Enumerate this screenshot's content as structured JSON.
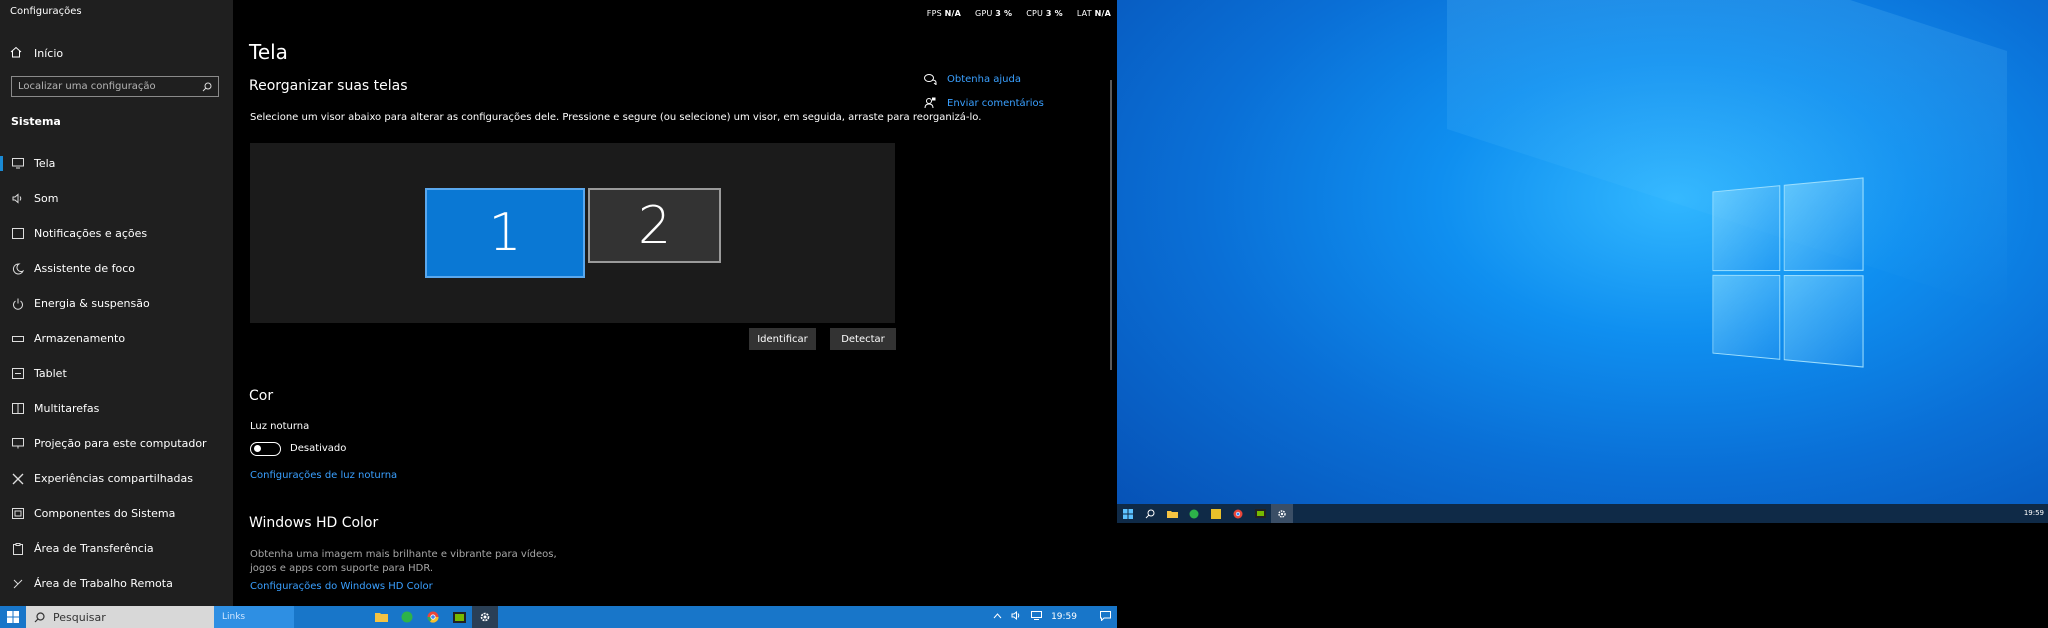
{
  "window": {
    "title": "Configurações"
  },
  "sidebar": {
    "home_label": "Início",
    "search_placeholder": "Localizar uma configuração",
    "group_label": "Sistema",
    "items": [
      {
        "label": "Tela",
        "icon": "display-icon"
      },
      {
        "label": "Som",
        "icon": "speaker-icon"
      },
      {
        "label": "Notificações e ações",
        "icon": "notification-icon"
      },
      {
        "label": "Assistente de foco",
        "icon": "moon-icon"
      },
      {
        "label": "Energia & suspensão",
        "icon": "power-icon"
      },
      {
        "label": "Armazenamento",
        "icon": "storage-icon"
      },
      {
        "label": "Tablet",
        "icon": "tablet-icon"
      },
      {
        "label": "Multitarefas",
        "icon": "multitask-icon"
      },
      {
        "label": "Projeção para este computador",
        "icon": "projection-icon"
      },
      {
        "label": "Experiências compartilhadas",
        "icon": "shared-icon"
      },
      {
        "label": "Componentes do Sistema",
        "icon": "components-icon"
      },
      {
        "label": "Área de Transferência",
        "icon": "clipboard-icon"
      },
      {
        "label": "Área de Trabalho Remota",
        "icon": "remote-icon"
      }
    ]
  },
  "overlay": {
    "fps_label": "FPS",
    "fps_value": "N/A",
    "gpu_label": "GPU",
    "gpu_value": "3 %",
    "cpu_label": "CPU",
    "cpu_value": "3 %",
    "lat_label": "LAT",
    "lat_value": "N/A"
  },
  "main": {
    "title": "Tela",
    "arrange_title": "Reorganizar suas telas",
    "arrange_desc": "Selecione um visor abaixo para alterar as configurações dele. Pressione e segure (ou selecione) um visor, em seguida, arraste para reorganizá-lo.",
    "monitor1_label": "1",
    "monitor2_label": "2",
    "identify_label": "Identificar",
    "detect_label": "Detectar",
    "color_title": "Cor",
    "night_light_label": "Luz noturna",
    "toggle_state": "Desativado",
    "night_light_link": "Configurações de luz noturna",
    "hdr_title": "Windows HD Color",
    "hdr_desc": "Obtenha uma imagem mais brilhante e vibrante para vídeos, jogos e apps com suporte para HDR.",
    "hdr_link": "Configurações do Windows HD Color"
  },
  "help": {
    "get_help": "Obtenha ajuda",
    "feedback": "Enviar comentários"
  },
  "taskbar": {
    "search_placeholder": "Pesquisar",
    "links_label": "Links",
    "time": "19:59",
    "accent": "#1876c9"
  },
  "desktop": {
    "time": "19:59"
  }
}
